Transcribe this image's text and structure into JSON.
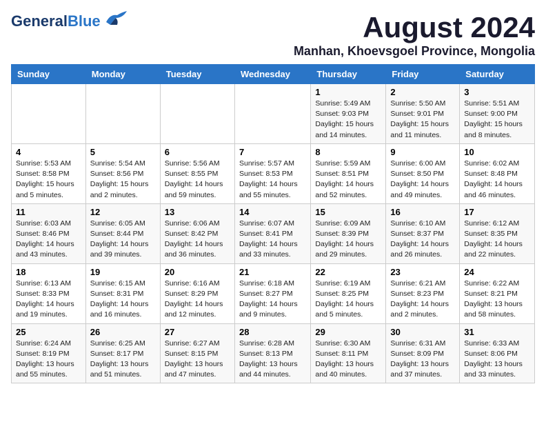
{
  "header": {
    "logo_general": "General",
    "logo_blue": "Blue",
    "month_title": "August 2024",
    "location": "Manhan, Khoevsgoel Province, Mongolia"
  },
  "weekdays": [
    "Sunday",
    "Monday",
    "Tuesday",
    "Wednesday",
    "Thursday",
    "Friday",
    "Saturday"
  ],
  "weeks": [
    [
      {
        "day": "",
        "info": ""
      },
      {
        "day": "",
        "info": ""
      },
      {
        "day": "",
        "info": ""
      },
      {
        "day": "",
        "info": ""
      },
      {
        "day": "1",
        "info": "Sunrise: 5:49 AM\nSunset: 9:03 PM\nDaylight: 15 hours\nand 14 minutes."
      },
      {
        "day": "2",
        "info": "Sunrise: 5:50 AM\nSunset: 9:01 PM\nDaylight: 15 hours\nand 11 minutes."
      },
      {
        "day": "3",
        "info": "Sunrise: 5:51 AM\nSunset: 9:00 PM\nDaylight: 15 hours\nand 8 minutes."
      }
    ],
    [
      {
        "day": "4",
        "info": "Sunrise: 5:53 AM\nSunset: 8:58 PM\nDaylight: 15 hours\nand 5 minutes."
      },
      {
        "day": "5",
        "info": "Sunrise: 5:54 AM\nSunset: 8:56 PM\nDaylight: 15 hours\nand 2 minutes."
      },
      {
        "day": "6",
        "info": "Sunrise: 5:56 AM\nSunset: 8:55 PM\nDaylight: 14 hours\nand 59 minutes."
      },
      {
        "day": "7",
        "info": "Sunrise: 5:57 AM\nSunset: 8:53 PM\nDaylight: 14 hours\nand 55 minutes."
      },
      {
        "day": "8",
        "info": "Sunrise: 5:59 AM\nSunset: 8:51 PM\nDaylight: 14 hours\nand 52 minutes."
      },
      {
        "day": "9",
        "info": "Sunrise: 6:00 AM\nSunset: 8:50 PM\nDaylight: 14 hours\nand 49 minutes."
      },
      {
        "day": "10",
        "info": "Sunrise: 6:02 AM\nSunset: 8:48 PM\nDaylight: 14 hours\nand 46 minutes."
      }
    ],
    [
      {
        "day": "11",
        "info": "Sunrise: 6:03 AM\nSunset: 8:46 PM\nDaylight: 14 hours\nand 43 minutes."
      },
      {
        "day": "12",
        "info": "Sunrise: 6:05 AM\nSunset: 8:44 PM\nDaylight: 14 hours\nand 39 minutes."
      },
      {
        "day": "13",
        "info": "Sunrise: 6:06 AM\nSunset: 8:42 PM\nDaylight: 14 hours\nand 36 minutes."
      },
      {
        "day": "14",
        "info": "Sunrise: 6:07 AM\nSunset: 8:41 PM\nDaylight: 14 hours\nand 33 minutes."
      },
      {
        "day": "15",
        "info": "Sunrise: 6:09 AM\nSunset: 8:39 PM\nDaylight: 14 hours\nand 29 minutes."
      },
      {
        "day": "16",
        "info": "Sunrise: 6:10 AM\nSunset: 8:37 PM\nDaylight: 14 hours\nand 26 minutes."
      },
      {
        "day": "17",
        "info": "Sunrise: 6:12 AM\nSunset: 8:35 PM\nDaylight: 14 hours\nand 22 minutes."
      }
    ],
    [
      {
        "day": "18",
        "info": "Sunrise: 6:13 AM\nSunset: 8:33 PM\nDaylight: 14 hours\nand 19 minutes."
      },
      {
        "day": "19",
        "info": "Sunrise: 6:15 AM\nSunset: 8:31 PM\nDaylight: 14 hours\nand 16 minutes."
      },
      {
        "day": "20",
        "info": "Sunrise: 6:16 AM\nSunset: 8:29 PM\nDaylight: 14 hours\nand 12 minutes."
      },
      {
        "day": "21",
        "info": "Sunrise: 6:18 AM\nSunset: 8:27 PM\nDaylight: 14 hours\nand 9 minutes."
      },
      {
        "day": "22",
        "info": "Sunrise: 6:19 AM\nSunset: 8:25 PM\nDaylight: 14 hours\nand 5 minutes."
      },
      {
        "day": "23",
        "info": "Sunrise: 6:21 AM\nSunset: 8:23 PM\nDaylight: 14 hours\nand 2 minutes."
      },
      {
        "day": "24",
        "info": "Sunrise: 6:22 AM\nSunset: 8:21 PM\nDaylight: 13 hours\nand 58 minutes."
      }
    ],
    [
      {
        "day": "25",
        "info": "Sunrise: 6:24 AM\nSunset: 8:19 PM\nDaylight: 13 hours\nand 55 minutes."
      },
      {
        "day": "26",
        "info": "Sunrise: 6:25 AM\nSunset: 8:17 PM\nDaylight: 13 hours\nand 51 minutes."
      },
      {
        "day": "27",
        "info": "Sunrise: 6:27 AM\nSunset: 8:15 PM\nDaylight: 13 hours\nand 47 minutes."
      },
      {
        "day": "28",
        "info": "Sunrise: 6:28 AM\nSunset: 8:13 PM\nDaylight: 13 hours\nand 44 minutes."
      },
      {
        "day": "29",
        "info": "Sunrise: 6:30 AM\nSunset: 8:11 PM\nDaylight: 13 hours\nand 40 minutes."
      },
      {
        "day": "30",
        "info": "Sunrise: 6:31 AM\nSunset: 8:09 PM\nDaylight: 13 hours\nand 37 minutes."
      },
      {
        "day": "31",
        "info": "Sunrise: 6:33 AM\nSunset: 8:06 PM\nDaylight: 13 hours\nand 33 minutes."
      }
    ]
  ]
}
